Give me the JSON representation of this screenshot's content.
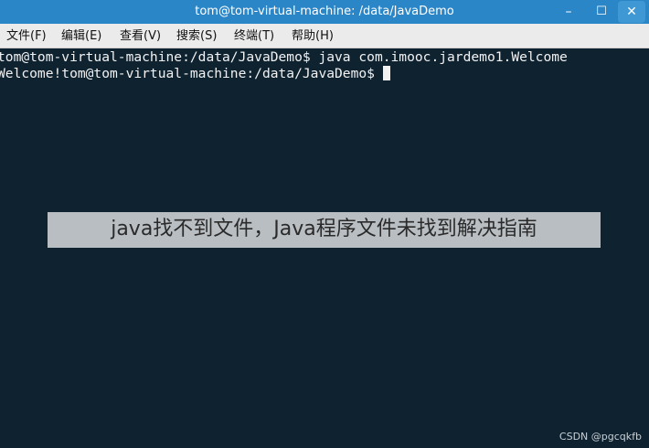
{
  "window": {
    "title": "tom@tom-virtual-machine: /data/JavaDemo",
    "controls": {
      "minimize": "–",
      "maximize": "☐",
      "close": "✕"
    }
  },
  "menu": {
    "items": [
      {
        "label": "文件(F)"
      },
      {
        "label": "编辑(E)"
      },
      {
        "label": "查看(V)"
      },
      {
        "label": "搜索(S)"
      },
      {
        "label": "终端(T)"
      },
      {
        "label": "帮助(H)"
      }
    ]
  },
  "terminal": {
    "lines": [
      "tom@tom-virtual-machine:/data/JavaDemo$ java com.imooc.jardemo1.Welcome",
      "Welcome!tom@tom-virtual-machine:/data/JavaDemo$"
    ]
  },
  "overlay": {
    "caption": "java找不到文件，Java程序文件未找到解决指南"
  },
  "watermark": {
    "text": "CSDN @pgcqkfb"
  },
  "colors": {
    "titlebar": "#2b86c8",
    "menubar": "#ebebeb",
    "terminal_bg": "#0f2230",
    "terminal_fg": "#f2f2f2"
  }
}
